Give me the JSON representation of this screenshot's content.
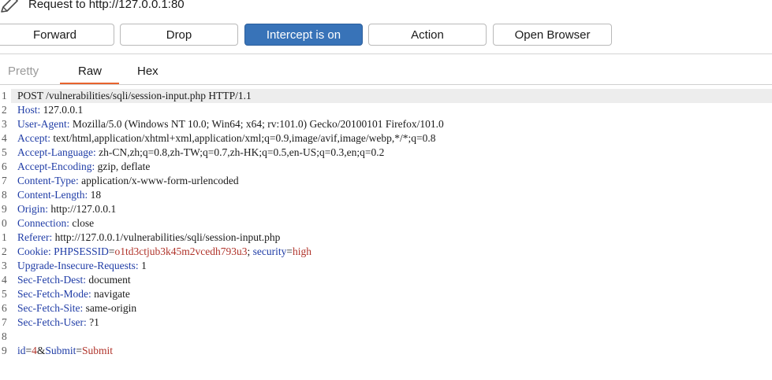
{
  "window": {
    "title": "Request to http://127.0.0.1:80"
  },
  "toolbar": {
    "forward_label": "Forward",
    "drop_label": "Drop",
    "intercept_label": "Intercept is on",
    "action_label": "Action",
    "open_browser_label": "Open Browser"
  },
  "tabs": {
    "pretty": "Pretty",
    "raw": "Raw",
    "hex": "Hex",
    "active": "Raw"
  },
  "colors": {
    "accent": "#3873b8",
    "tab_underline": "#e8642e",
    "header_key": "#1f3ca6",
    "param_value": "#b0332a"
  },
  "request": {
    "lines": [
      {
        "num": "1",
        "text": "POST /vulnerabilities/sqli/session-input.php HTTP/1.1"
      },
      {
        "num": "2",
        "key": "Host:",
        "value": " 127.0.0.1"
      },
      {
        "num": "3",
        "key": "User-Agent:",
        "value": " Mozilla/5.0 (Windows NT 10.0; Win64; x64; rv:101.0) Gecko/20100101 Firefox/101.0"
      },
      {
        "num": "4",
        "key": "Accept:",
        "value": " text/html,application/xhtml+xml,application/xml;q=0.9,image/avif,image/webp,*/*;q=0.8"
      },
      {
        "num": "5",
        "key": "Accept-Language:",
        "value": " zh-CN,zh;q=0.8,zh-TW;q=0.7,zh-HK;q=0.5,en-US;q=0.3,en;q=0.2"
      },
      {
        "num": "6",
        "key": "Accept-Encoding:",
        "value": " gzip, deflate"
      },
      {
        "num": "7",
        "key": "Content-Type:",
        "value": " application/x-www-form-urlencoded"
      },
      {
        "num": "8",
        "key": "Content-Length:",
        "value": " 18"
      },
      {
        "num": "9",
        "key": "Origin:",
        "value": " http://127.0.0.1"
      },
      {
        "num": "0",
        "key": "Connection:",
        "value": " close"
      },
      {
        "num": "1",
        "key": "Referer:",
        "value": " http://127.0.0.1/vulnerabilities/sqli/session-input.php"
      },
      {
        "num": "2",
        "key": "Cookie:",
        "parts": [
          {
            "t": " ",
            "c": "v"
          },
          {
            "t": "PHPSESSID",
            "c": "ck"
          },
          {
            "t": "=",
            "c": "v"
          },
          {
            "t": "o1td3ctjub3k45m2vcedh793u3",
            "c": "cv"
          },
          {
            "t": "; ",
            "c": "v"
          },
          {
            "t": "security",
            "c": "ck"
          },
          {
            "t": "=",
            "c": "v"
          },
          {
            "t": "high",
            "c": "cv"
          }
        ]
      },
      {
        "num": "3",
        "key": "Upgrade-Insecure-Requests:",
        "value": " 1"
      },
      {
        "num": "4",
        "key": "Sec-Fetch-Dest:",
        "value": " document"
      },
      {
        "num": "5",
        "key": "Sec-Fetch-Mode:",
        "value": " navigate"
      },
      {
        "num": "6",
        "key": "Sec-Fetch-Site:",
        "value": " same-origin"
      },
      {
        "num": "7",
        "key": "Sec-Fetch-User:",
        "value": " ?1"
      },
      {
        "num": "8",
        "text": ""
      },
      {
        "num": "9",
        "parts": [
          {
            "t": "id",
            "c": "ck"
          },
          {
            "t": "=",
            "c": "v"
          },
          {
            "t": "4",
            "c": "cv"
          },
          {
            "t": "&",
            "c": "v"
          },
          {
            "t": "Submit",
            "c": "ck"
          },
          {
            "t": "=",
            "c": "v"
          },
          {
            "t": "Submit",
            "c": "cv"
          }
        ]
      }
    ]
  }
}
